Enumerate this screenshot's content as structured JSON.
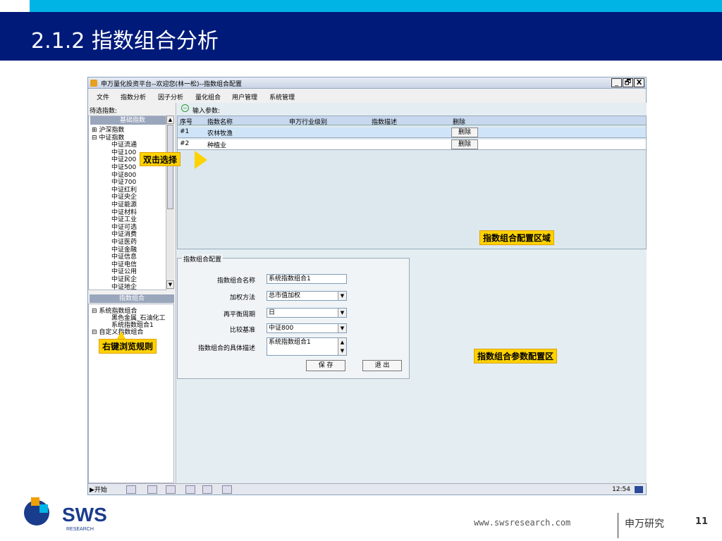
{
  "slide": {
    "title": "2.1.2 指数组合分析",
    "callouts": {
      "double_click": "双击选择",
      "right_click": "右键浏览规则",
      "config_area": "指数组合配置区域",
      "param_area": "指数组合参数配置区"
    },
    "footer": {
      "url": "www.swsresearch.com",
      "org": "申万研究",
      "page": "11"
    },
    "logo": {
      "text": "SWS",
      "sub": "RESEARCH"
    }
  },
  "window": {
    "title": "申万量化投资平台--欢迎您(林一松)--指数组合配置",
    "buttons": {
      "minimize": "_",
      "restore": "🗗",
      "close": "X"
    },
    "menu": [
      "文件",
      "指数分析",
      "因子分析",
      "量化组合",
      "用户管理",
      "系统管理"
    ]
  },
  "left": {
    "label": "待选指数:",
    "base_header": "基础指数",
    "tree": [
      "⊞ 沪深指数",
      "⊟ 中证指数",
      "中证流通",
      "中证100",
      "中证200",
      "中证500",
      "中证800",
      "中证700",
      "中证红利",
      "中证央企",
      "中证能源",
      "中证材料",
      "中证工业",
      "中证可选",
      "中证消费",
      "中证医药",
      "中证金融",
      "中证信息",
      "中证电信",
      "中证公用",
      "中证民企",
      "中证地企"
    ],
    "combo_header": "指数组合",
    "combo_tree": [
      "⊟ 系统指数组合",
      "黑色金属_石油化工",
      "系统指数组合1",
      "⊟ 自定义指数组合"
    ]
  },
  "params": {
    "label": "输入参数:",
    "columns": [
      "序号",
      "指数名称",
      "申万行业级别",
      "指数描述",
      "删除"
    ],
    "rows": [
      {
        "no": "#1",
        "name": "农林牧渔",
        "level": "",
        "desc": "",
        "del": "删除"
      },
      {
        "no": "#2",
        "name": "种植业",
        "level": "",
        "desc": "",
        "del": "删除"
      }
    ]
  },
  "config": {
    "legend": "指数组合配置",
    "name_label": "指数组合名称",
    "name_value": "系统指数组合1",
    "weight_label": "加权方法",
    "weight_value": "总市值加权",
    "period_label": "再平衡周期",
    "period_value": "日",
    "bench_label": "比较基准",
    "bench_value": "中证800",
    "desc_label": "指数组合的具体描述",
    "desc_value": "系统指数组合1",
    "save": "保 存",
    "exit": "退 出"
  },
  "taskbar": {
    "start": "开始",
    "clock": "12:54"
  },
  "colors": {
    "title_bg": "#001a7a",
    "stripe": "#00b4e6",
    "callout": "#ffd200"
  }
}
